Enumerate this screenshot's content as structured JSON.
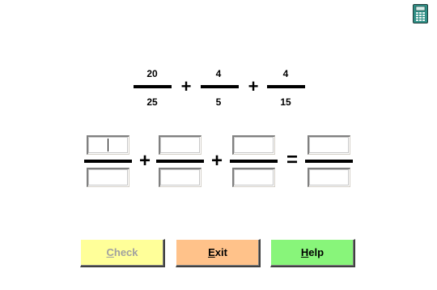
{
  "problem": {
    "fractions": [
      {
        "numerator": "20",
        "denominator": "25"
      },
      {
        "numerator": "4",
        "denominator": "5"
      },
      {
        "numerator": "4",
        "denominator": "15"
      }
    ],
    "operators": [
      "+",
      "+"
    ]
  },
  "answer": {
    "operators": [
      "+",
      "+",
      "="
    ],
    "fields": [
      {
        "numerator_value": "",
        "denominator_value": ""
      },
      {
        "numerator_value": "",
        "denominator_value": ""
      },
      {
        "numerator_value": "",
        "denominator_value": ""
      },
      {
        "numerator_value": "",
        "denominator_value": ""
      }
    ]
  },
  "buttons": {
    "check": {
      "label_hotkey": "C",
      "label_rest": "heck",
      "state": "disabled"
    },
    "exit": {
      "label_hotkey": "E",
      "label_rest": "xit"
    },
    "help": {
      "label_hotkey": "H",
      "label_rest": "elp"
    }
  },
  "icons": {
    "top_right": "calculator-icon"
  },
  "colors": {
    "check_button": "#ffff99",
    "exit_button": "#ffc28a",
    "help_button": "#88f57a",
    "calculator_icon": "#2f8f86"
  }
}
